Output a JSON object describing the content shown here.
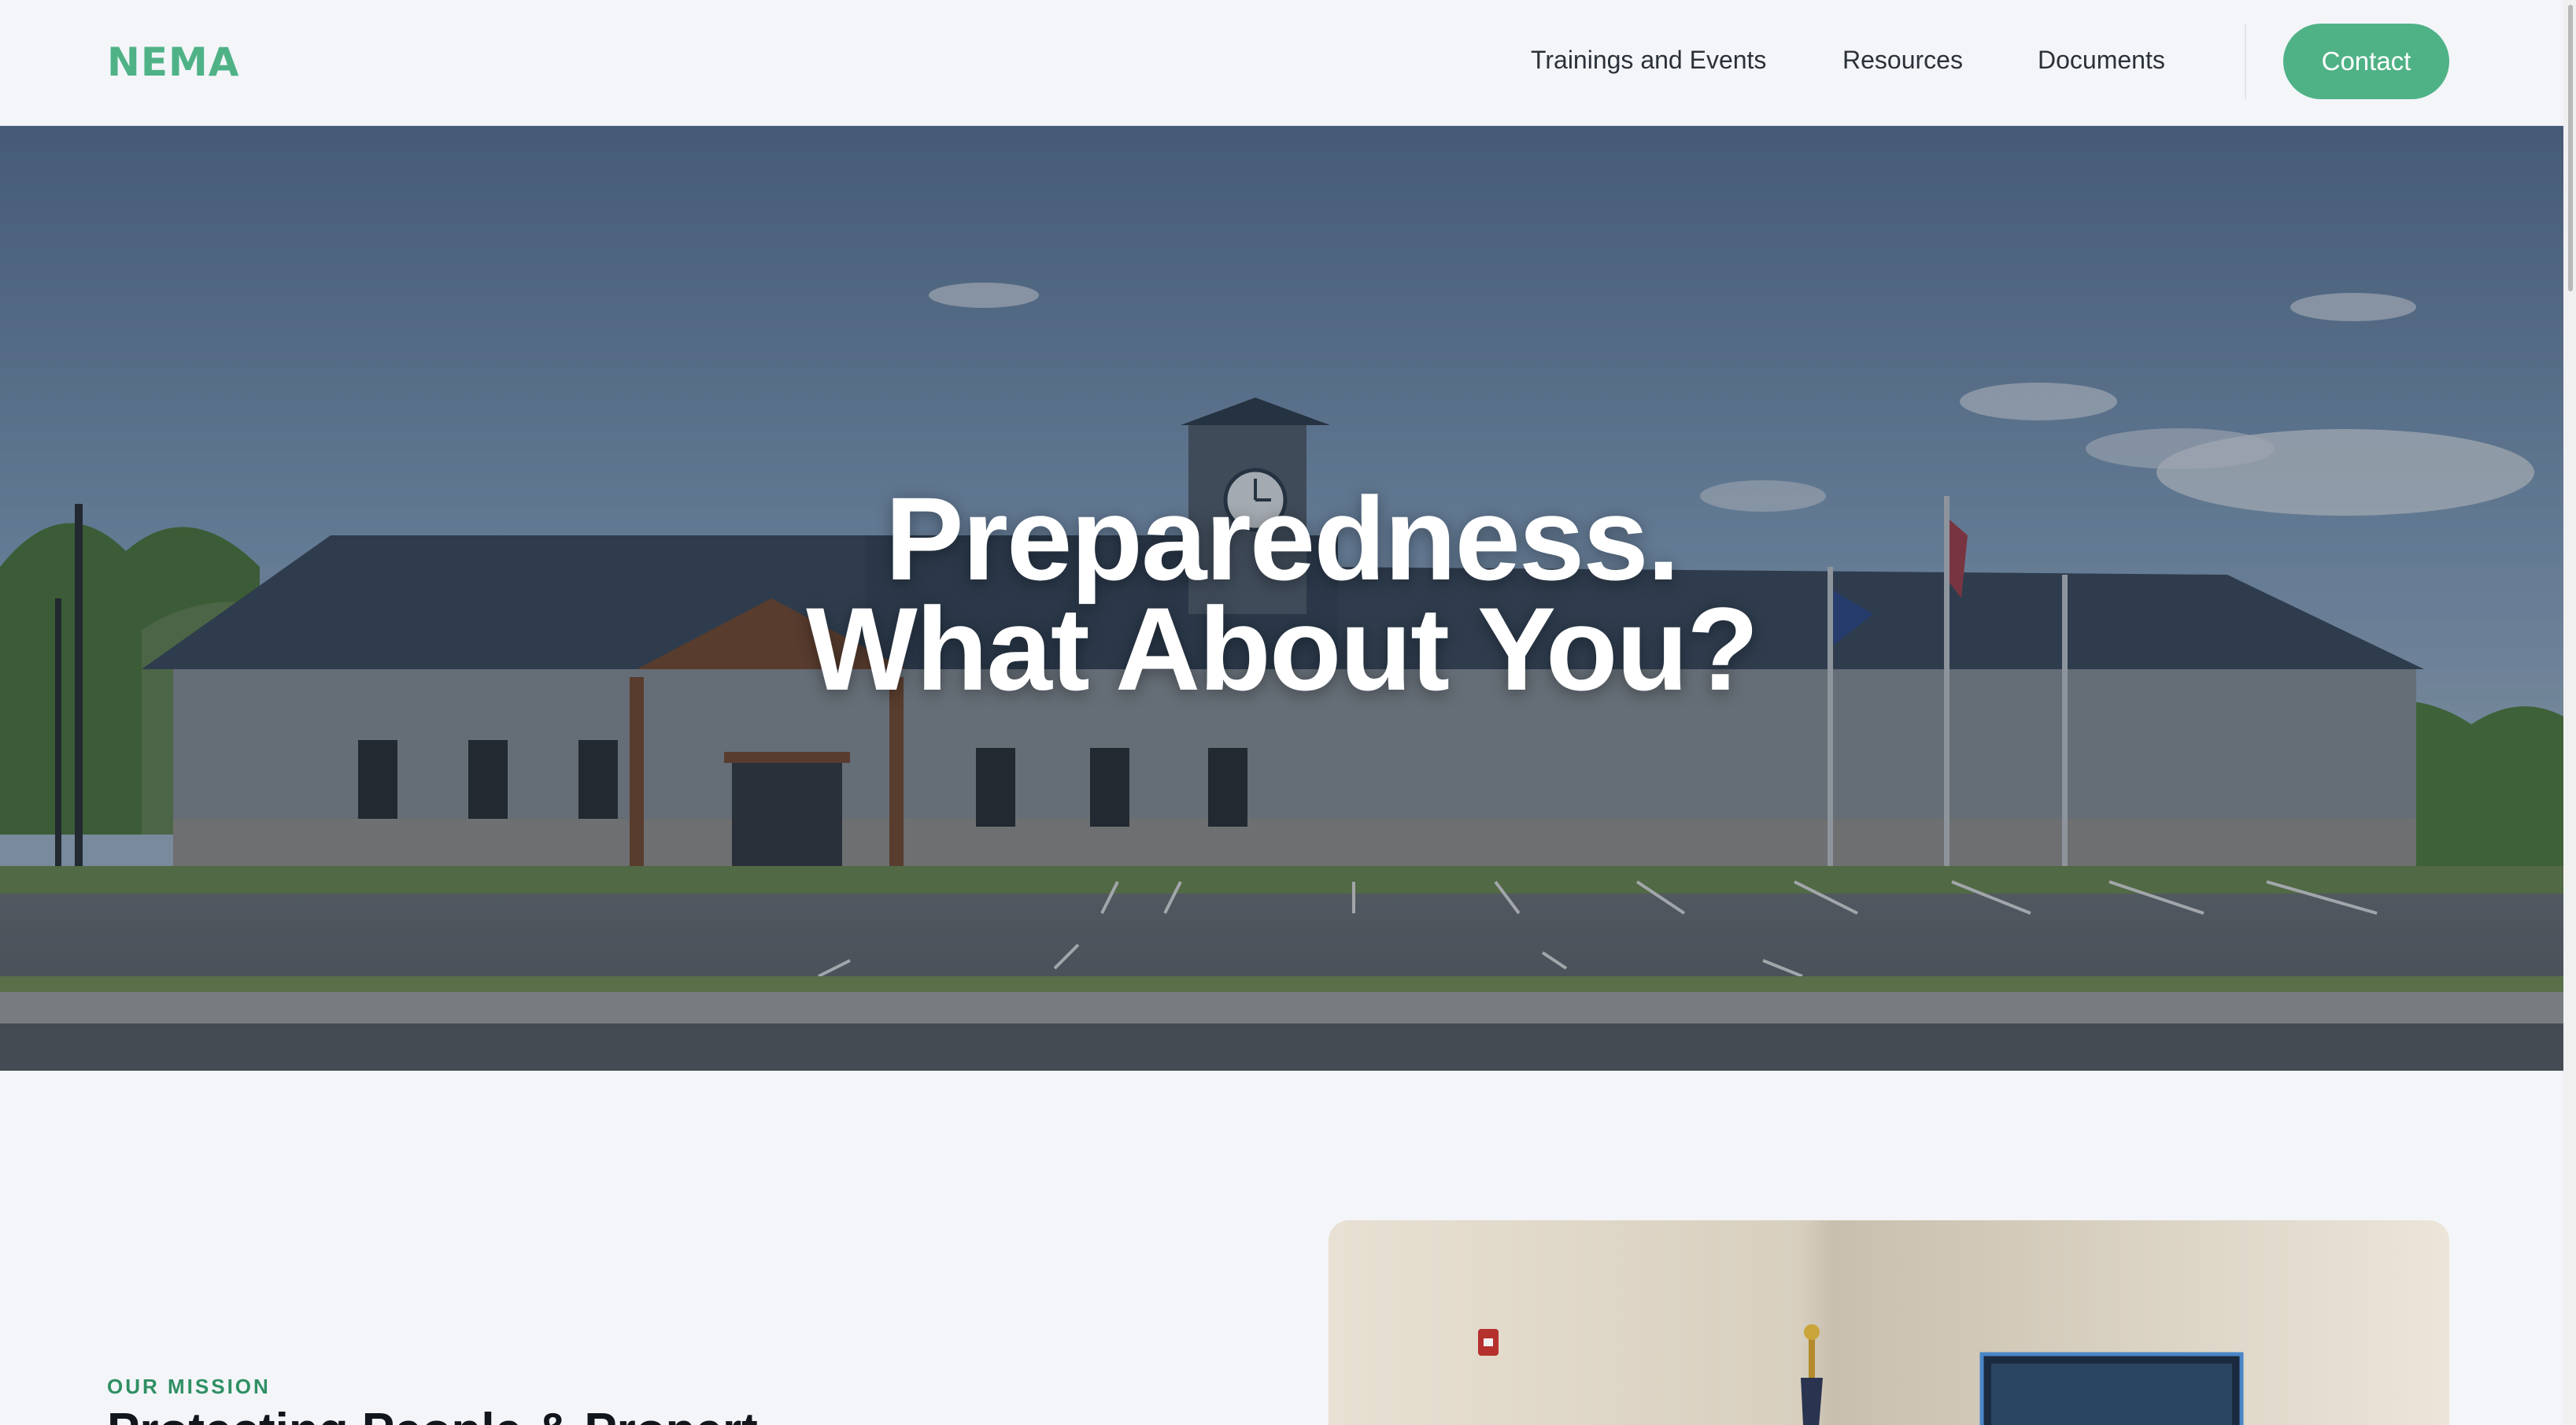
{
  "header": {
    "logo": "NEMA",
    "nav": [
      {
        "label": "Trainings and Events"
      },
      {
        "label": "Resources"
      },
      {
        "label": "Documents"
      }
    ],
    "contact_label": "Contact"
  },
  "hero": {
    "line1": "Preparedness.",
    "line2": "What About You?",
    "image": "building-exterior-photo"
  },
  "mission": {
    "eyebrow": "OUR MISSION",
    "title": "Protecting People & Propert",
    "image": "operations-room-photo"
  },
  "colors": {
    "accent": "#4fb286",
    "background": "#f3f5f9",
    "eyebrow": "#2f8f63"
  }
}
